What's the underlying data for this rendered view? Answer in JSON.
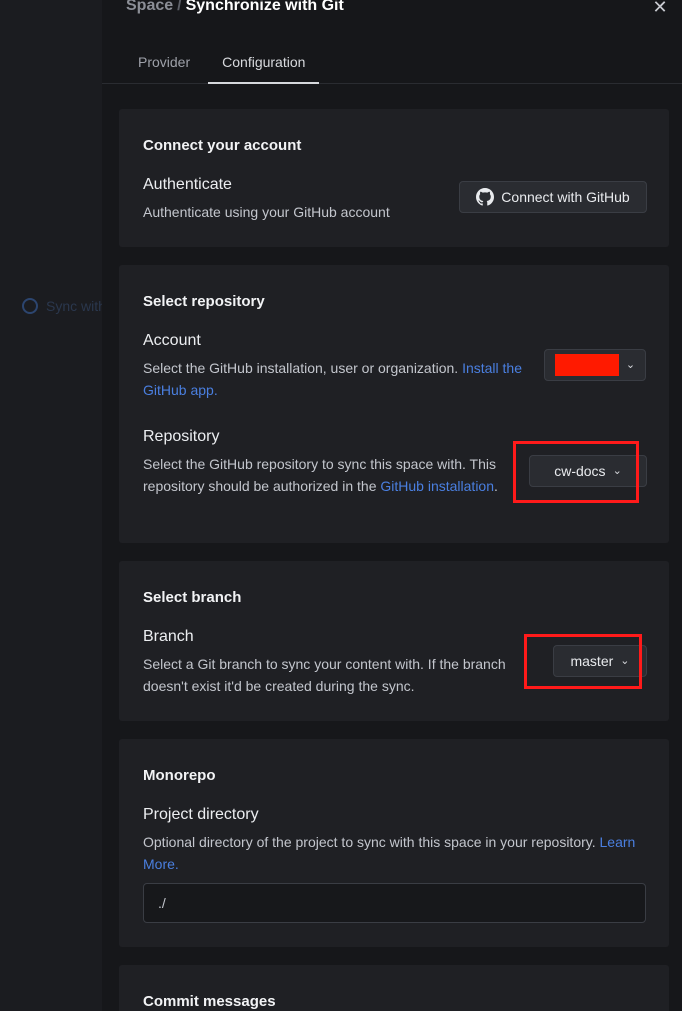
{
  "background": {
    "sidebar_item": "Sync with Git"
  },
  "dialog": {
    "breadcrumb_space": "Space",
    "breadcrumb_sep": "/",
    "title": "Synchronize with Git",
    "close_glyph": "✕",
    "tabs": [
      {
        "label": "Provider",
        "active": false
      },
      {
        "label": "Configuration",
        "active": true
      }
    ]
  },
  "connect": {
    "title": "Connect your account",
    "label": "Authenticate",
    "desc": "Authenticate using your GitHub account",
    "button_label": "Connect with GitHub",
    "button_icon": "github-icon"
  },
  "repository": {
    "title": "Select repository",
    "account_label": "Account",
    "account_desc": "Select the GitHub installation, user or organization.",
    "account_link": "Install the GitHub app.",
    "account_link_line1": "Install",
    "account_link_line2": "the GitHub app.",
    "account_value_redacted": true,
    "repo_label": "Repository",
    "repo_desc_line1": "Select the GitHub repository to sync this space with. This",
    "repo_desc_line2": "repository should be authorized in the",
    "repo_link_line1": "GitHub",
    "repo_link_line2": "installation",
    "repo_desc_end": ".",
    "repo_value": "cw-docs"
  },
  "branch": {
    "title": "Select branch",
    "label": "Branch",
    "desc_line1": "Select a Git branch to sync your content with. If the branch",
    "desc_line2": "doesn't exist it'd be created during the sync.",
    "value": "master"
  },
  "monorepo": {
    "title": "Monorepo",
    "label": "Project directory",
    "desc": "Optional directory of the project to sync with this space in your repository.",
    "link": "Learn More.",
    "value": "./"
  },
  "commit": {
    "title": "Commit messages"
  },
  "colors": {
    "highlight": "#ff1a1a",
    "link": "#4a7fe0",
    "redaction": "#ff1a00"
  }
}
